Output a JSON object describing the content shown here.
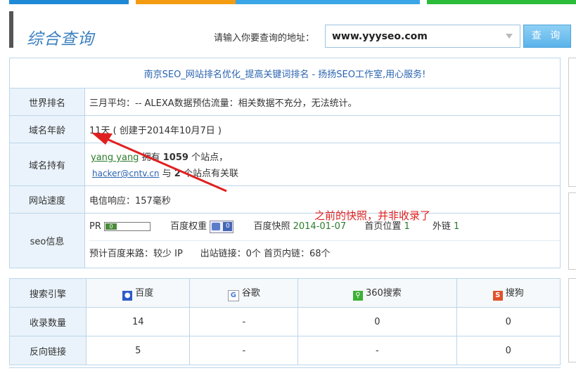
{
  "colors": {
    "top_blue": "#1e8ad6",
    "top_orange": "#f39c12",
    "top_sky": "#3aa6e8",
    "top_green": "#2dbb3a",
    "accent": "#3a7fbf",
    "annotation": "#e02020"
  },
  "header": {
    "title": "综合查询",
    "search_label": "请输入你要查询的地址：",
    "search_value": "www.yyyseo.com",
    "query_button": "查 询"
  },
  "banner": "南京SEO_网站排名优化_提高关键词排名 - 扬扬SEO工作室,用心服务!",
  "rows": {
    "world_rank": {
      "label": "世界排名",
      "value": "三月平均：--  ALEXA数据预估流量：相关数据不充分，无法统计。"
    },
    "domain_age": {
      "label": "域名年龄",
      "value": "11天 ( 创建于2014年10月7日 )"
    },
    "domain_owner": {
      "label": "域名持有",
      "owner_name": "yang yang",
      "owns_text": "拥有",
      "site_count": "1059",
      "sites_text": "个站点，",
      "email": "hacker@cntv.cn",
      "related_prefix": "与",
      "related_count": "2",
      "related_suffix": "个站点有关联"
    },
    "site_speed": {
      "label": "网站速度",
      "value": "电信响应：157毫秒"
    },
    "seo_info": {
      "label": "seo信息",
      "pr_label": "PR",
      "pr_value": "0",
      "baidu_weight_label": "百度权重",
      "baidu_weight_value": "0",
      "snapshot_label": "百度快照",
      "snapshot_value": "2014-01-07",
      "home_position_label": "首页位置",
      "home_position_value": "1",
      "external_links_label": "外链",
      "external_links_value": "1",
      "line2": "预计百度来路：较少 IP      出站链接：0个 首页内链：68个"
    }
  },
  "engines": {
    "header_label": "搜索引擎",
    "columns": [
      {
        "name": "百度",
        "icon": "baidu-icon",
        "color": "#2e5cc6"
      },
      {
        "name": "谷歌",
        "icon": "google-icon",
        "color": "#4a7bd4"
      },
      {
        "name": "360搜索",
        "icon": "so360-icon",
        "color": "#3cb034"
      },
      {
        "name": "搜狗",
        "icon": "sogou-icon",
        "color": "#e0522a"
      }
    ],
    "indexed_label": "收录数量",
    "indexed": [
      "14",
      "-",
      "0",
      "0"
    ],
    "backlinks_label": "反向链接",
    "backlinks": [
      "5",
      "-",
      "-",
      "0"
    ]
  },
  "annotation": "之前的快照，并非收录了"
}
